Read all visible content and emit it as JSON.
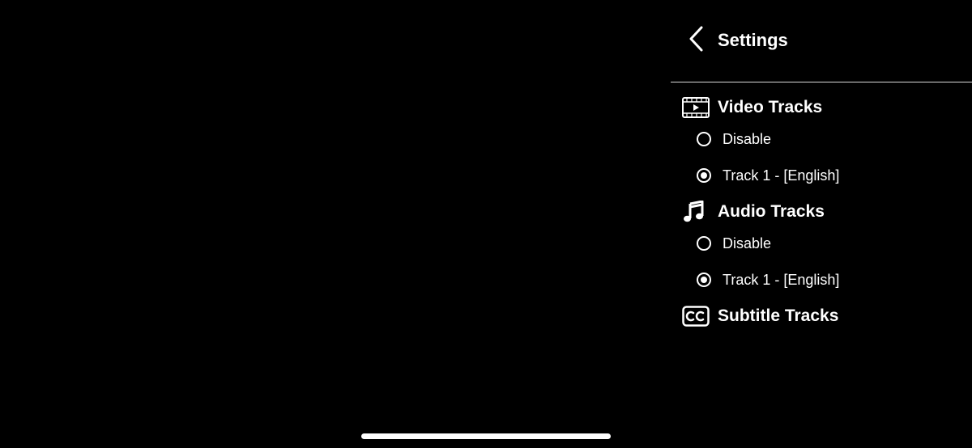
{
  "header": {
    "back_icon": "chevron-left-icon",
    "title": "Settings"
  },
  "sections": {
    "video": {
      "icon": "film-icon",
      "label": "Video Tracks",
      "options": [
        {
          "label": "Disable",
          "selected": false
        },
        {
          "label": "Track 1 - [English]",
          "selected": true
        }
      ]
    },
    "audio": {
      "icon": "music-note-icon",
      "label": "Audio Tracks",
      "options": [
        {
          "label": "Disable",
          "selected": false
        },
        {
          "label": "Track 1 - [English]",
          "selected": true
        }
      ]
    },
    "subtitle": {
      "icon": "closed-caption-icon",
      "label": "Subtitle Tracks"
    }
  },
  "colors": {
    "background": "#000000",
    "foreground": "#ffffff",
    "divider": "#d9d9d9"
  }
}
